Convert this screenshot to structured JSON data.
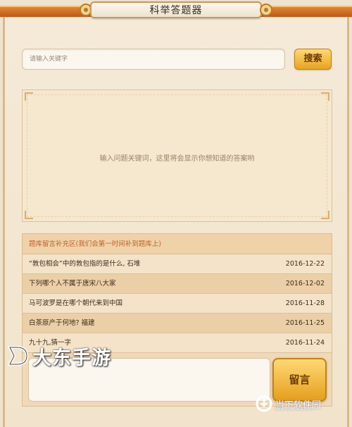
{
  "app": {
    "title": "科举答题器"
  },
  "search": {
    "placeholder": "请输入关键字",
    "button_label": "搜索"
  },
  "answer_panel": {
    "hint": "输入问题关键词，这里将会显示你想知道的答案哟"
  },
  "board": {
    "header": "题库留言补充区(我们会第一时间补到题库上)",
    "rows": [
      {
        "question": "“敦包相会”中的敦包指的是什么, 石堆",
        "date": "2016-12-22"
      },
      {
        "question": "下列哪个人不属于唐宋八大家",
        "date": "2016-12-02"
      },
      {
        "question": "马可波罗是在哪个朝代来到中国",
        "date": "2016-11-28"
      },
      {
        "question": "白茶原产于何地? 福建",
        "date": "2016-11-25"
      },
      {
        "question": "九十九,猜一字",
        "date": "2016-11-24"
      }
    ]
  },
  "message": {
    "button_label": "留言"
  },
  "watermarks": {
    "left": "大东手游",
    "right": "当下软件园",
    "right_sub": "www.downxia.com"
  },
  "colors": {
    "accent_orange": "#e2842e",
    "button_gold": "#f0b43a",
    "header_text": "#c0622a"
  }
}
